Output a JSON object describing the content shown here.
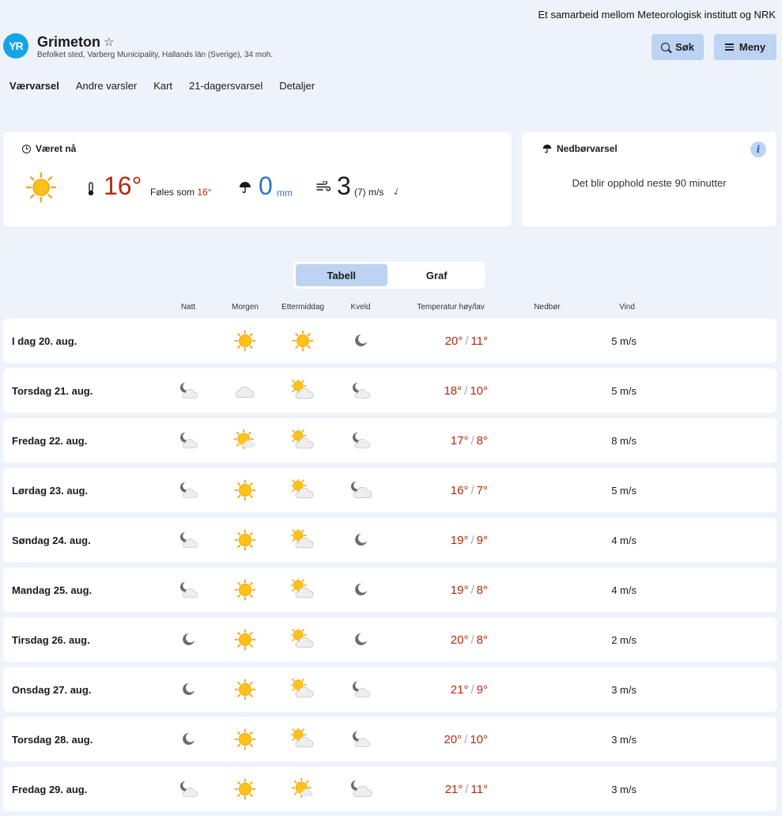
{
  "header": {
    "partnership": "Et samarbeid mellom Meteorologisk institutt og NRK",
    "logo": "YR",
    "place_name": "Grimeton",
    "place_sub": "Befolket sted, Varberg Municipality, Hallands län (Sverige), 34 moh.",
    "search_label": "Søk",
    "menu_label": "Meny"
  },
  "nav": [
    "Værvarsel",
    "Andre varsler",
    "Kart",
    "21-dagersvarsel",
    "Detaljer"
  ],
  "now": {
    "title": "Været nå",
    "temp": "16°",
    "feels_prefix": "Føles som",
    "feels_value": "16°",
    "precip": "0",
    "precip_unit": "mm",
    "wind": "3",
    "gust": "(7) m/s"
  },
  "precip_card": {
    "title": "Nedbørvarsel",
    "message": "Det blir opphold neste 90 minutter"
  },
  "toggle": {
    "table": "Tabell",
    "graph": "Graf"
  },
  "columns": [
    "Natt",
    "Morgen",
    "Ettermiddag",
    "Kveld",
    "Temperatur høy/lav",
    "Nedbør",
    "Vind"
  ],
  "days": [
    {
      "label": "I dag 20. aug.",
      "icons": [
        "",
        "sun",
        "sun",
        "moon"
      ],
      "high": "20°",
      "low": "11°",
      "wind": "5 m/s"
    },
    {
      "label": "Torsdag 21. aug.",
      "icons": [
        "moon-cloud",
        "cloud",
        "sun-cloud",
        "moon-cloud"
      ],
      "high": "18°",
      "low": "10°",
      "wind": "5 m/s"
    },
    {
      "label": "Fredag 22. aug.",
      "icons": [
        "moon-cloud",
        "sun-cloud-small",
        "sun-cloud",
        "moon-cloud"
      ],
      "high": "17°",
      "low": "8°",
      "wind": "8 m/s"
    },
    {
      "label": "Lørdag 23. aug.",
      "icons": [
        "moon-cloud",
        "sun",
        "sun-cloud",
        "moon-cloud-big"
      ],
      "high": "16°",
      "low": "7°",
      "wind": "5 m/s"
    },
    {
      "label": "Søndag 24. aug.",
      "icons": [
        "moon-cloud",
        "sun",
        "sun-cloud",
        "moon"
      ],
      "high": "19°",
      "low": "9°",
      "wind": "4 m/s"
    },
    {
      "label": "Mandag 25. aug.",
      "icons": [
        "moon-cloud",
        "sun",
        "sun-cloud",
        "moon"
      ],
      "high": "19°",
      "low": "8°",
      "wind": "4 m/s"
    },
    {
      "label": "Tirsdag 26. aug.",
      "icons": [
        "moon",
        "sun",
        "sun-cloud",
        "moon"
      ],
      "high": "20°",
      "low": "8°",
      "wind": "2 m/s"
    },
    {
      "label": "Onsdag 27. aug.",
      "icons": [
        "moon",
        "sun",
        "sun-cloud",
        "moon-cloud"
      ],
      "high": "21°",
      "low": "9°",
      "wind": "3 m/s"
    },
    {
      "label": "Torsdag 28. aug.",
      "icons": [
        "moon",
        "sun",
        "sun-cloud",
        "moon-cloud"
      ],
      "high": "20°",
      "low": "10°",
      "wind": "3 m/s"
    },
    {
      "label": "Fredag 29. aug.",
      "icons": [
        "moon-cloud",
        "sun",
        "sun-cloud-small",
        "moon-cloud-big"
      ],
      "high": "21°",
      "low": "11°",
      "wind": "3 m/s"
    }
  ],
  "colors": {
    "temp_warm": "#b5290d",
    "precip_blue": "#2f74c4",
    "accent": "#bcd3f2",
    "logo": "#15a4e7"
  }
}
